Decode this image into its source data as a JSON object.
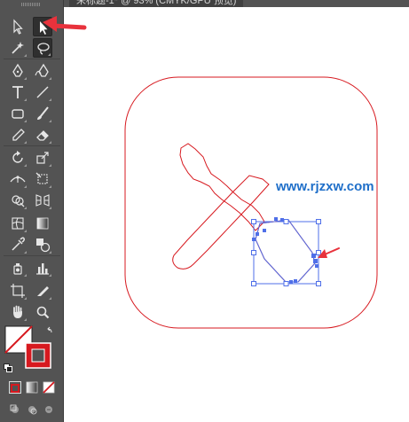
{
  "document": {
    "tab_title": "未标题-1* @ 93% (CMYK/GPU 预览)"
  },
  "colors": {
    "panel": "#535353",
    "artwork_stroke": "#d7191f",
    "selection_blue": "#4f6fe8",
    "arrow_red": "#e8323c",
    "watermark_blue": "#1f6fc9"
  },
  "watermark": {
    "text": "www.rjzxw.com"
  },
  "toolbar": {
    "tools": [
      "selection-tool",
      "direct-selection-tool",
      "magic-wand-tool",
      "lasso-tool",
      "pen-tool",
      "curvature-tool",
      "type-tool",
      "line-segment-tool",
      "rectangle-tool",
      "paintbrush-tool",
      "pencil-tool",
      "eraser-tool",
      "rotate-tool",
      "scale-tool",
      "width-tool",
      "free-transform-tool",
      "shape-builder-tool",
      "perspective-grid-tool",
      "mesh-tool",
      "gradient-tool",
      "eyedropper-tool",
      "blend-tool",
      "symbol-sprayer-tool",
      "column-graph-tool",
      "artboard-tool",
      "slice-tool",
      "hand-tool",
      "zoom-tool"
    ],
    "active_tool": "direct-selection-tool"
  }
}
